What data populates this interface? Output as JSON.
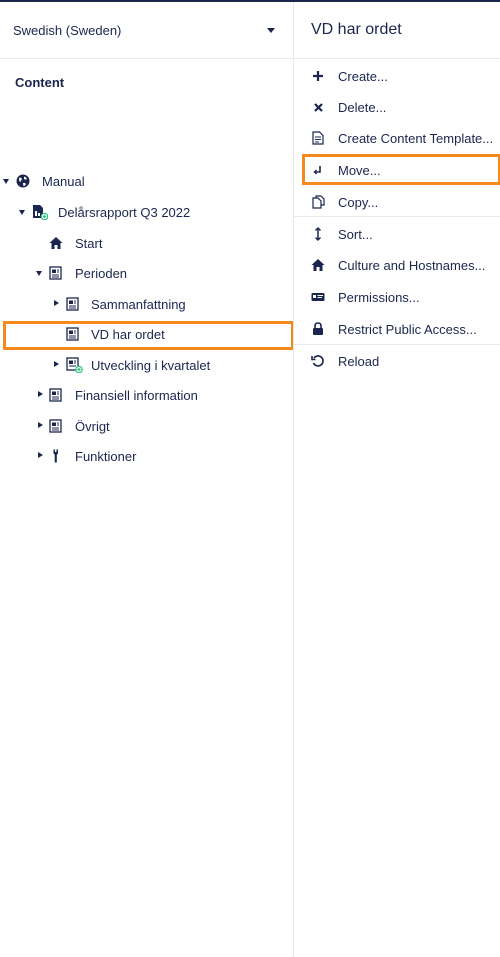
{
  "tree": {
    "language": "Swedish (Sweden)",
    "section_title": "Content",
    "nodes": [
      {
        "label": "Manual",
        "icon": "globe-icon"
      },
      {
        "label": "Delårsrapport Q3 2022",
        "icon": "document-add-icon"
      },
      {
        "label": "Start",
        "icon": "home-icon"
      },
      {
        "label": "Perioden",
        "icon": "article-icon"
      },
      {
        "label": "Sammanfattning",
        "icon": "article-icon"
      },
      {
        "label": "VD har ordet",
        "icon": "article-icon"
      },
      {
        "label": "Utveckling i kvartalet",
        "icon": "article-add-icon"
      },
      {
        "label": "Finansiell information",
        "icon": "article-icon"
      },
      {
        "label": "Övrigt",
        "icon": "article-icon"
      },
      {
        "label": "Funktioner",
        "icon": "wrench-icon"
      }
    ]
  },
  "actions": {
    "title": "VD har ordet",
    "items": [
      {
        "label": "Create...",
        "icon": "plus-icon"
      },
      {
        "label": "Delete...",
        "icon": "close-icon"
      },
      {
        "label": "Create Content Template...",
        "icon": "template-icon"
      },
      {
        "label": "Move...",
        "icon": "move-icon"
      },
      {
        "label": "Copy...",
        "icon": "copy-icon"
      },
      {
        "label": "Sort...",
        "icon": "sort-icon"
      },
      {
        "label": "Culture and Hostnames...",
        "icon": "home-icon"
      },
      {
        "label": "Permissions...",
        "icon": "permissions-icon"
      },
      {
        "label": "Restrict Public Access...",
        "icon": "lock-icon"
      },
      {
        "label": "Reload",
        "icon": "reload-icon"
      }
    ]
  },
  "colors": {
    "text": "#1b264f",
    "highlight": "#f5891d",
    "add_badge": "#2bc37c",
    "border": "#e9e9eb"
  }
}
